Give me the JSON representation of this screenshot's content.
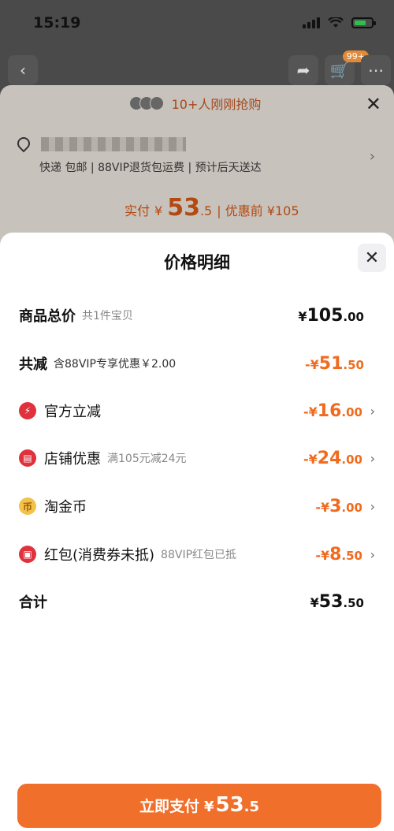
{
  "status": {
    "time": "15:19"
  },
  "background": {
    "cart_badge": "99+",
    "banner_text": "10+人刚刚抢购",
    "address_line2": "快递 包邮 | 88VIP退货包运费 | 预计后天送达",
    "price_label": "实付",
    "price_currency": "¥",
    "price_int": "53",
    "price_dec": ".5",
    "price_before": "| 优惠前 ¥105"
  },
  "modal": {
    "title": "价格明细",
    "rows": [
      {
        "label": "商品总价",
        "sub": "共1件宝贝",
        "cur": "¥",
        "int": "105",
        "dec": ".00"
      },
      {
        "label": "共减",
        "sub": "含88VIP专享优惠￥2.00",
        "cur": "-¥",
        "int": "51",
        "dec": ".50"
      },
      {
        "label": "官方立减",
        "sub": "",
        "cur": "-¥",
        "int": "16",
        "dec": ".00",
        "icon": "lightning-icon"
      },
      {
        "label": "店铺优惠",
        "sub": "满105元减24元",
        "cur": "-¥",
        "int": "24",
        "dec": ".00",
        "icon": "shop-icon"
      },
      {
        "label": "淘金币",
        "sub": "",
        "cur": "-¥",
        "int": "3",
        "dec": ".00",
        "icon": "coin-icon"
      },
      {
        "label": "红包(消费券未抵)",
        "sub": "88VIP红包已抵",
        "cur": "-¥",
        "int": "8",
        "dec": ".50",
        "icon": "red-packet-icon"
      },
      {
        "label": "合计",
        "sub": "",
        "cur": "¥",
        "int": "53",
        "dec": ".50"
      }
    ]
  },
  "pay_button": {
    "label": "立即支付",
    "cur": "¥",
    "int": "53",
    "dec": ".5"
  },
  "colors": {
    "accent": "#ef6f2b",
    "discount": "#f06b1f"
  }
}
